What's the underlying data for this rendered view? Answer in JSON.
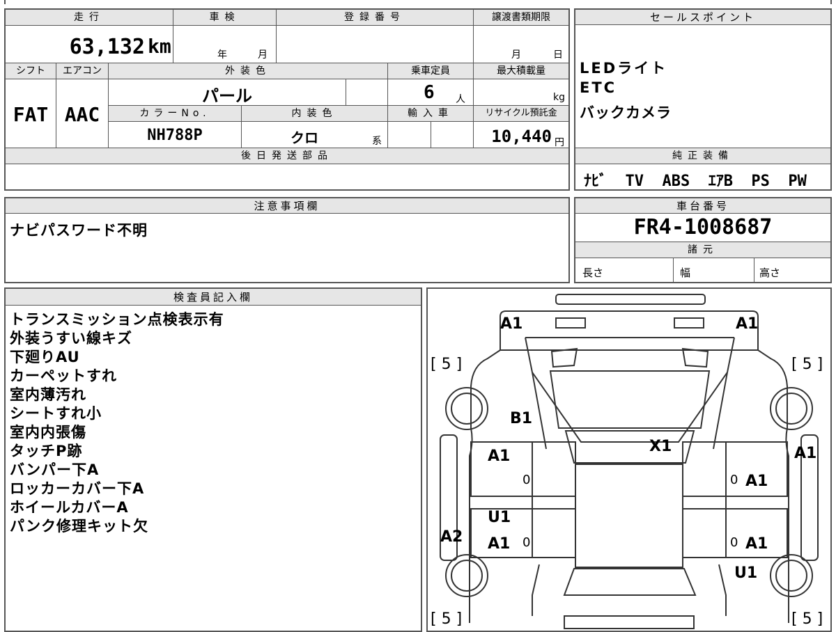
{
  "top_row": {
    "mileage_label": "走行",
    "inspection_label": "車検",
    "registration_label": "登録番号",
    "transfer_deadline_label": "譲渡書類期限",
    "mileage_value": "63,132",
    "mileage_unit": "km",
    "year_unit": "年",
    "month_unit": "月",
    "deadline_month": "月",
    "deadline_day": "日"
  },
  "second_row": {
    "shift_label": "シフト",
    "aircon_label": "エアコン",
    "exterior_color_label": "外装色",
    "capacity_label": "乗車定員",
    "max_load_label": "最大積載量",
    "shift_value": "FAT",
    "aircon_value": "AAC",
    "exterior_color_value": "パール",
    "capacity_value": "6",
    "capacity_unit": "人",
    "load_unit": "kg",
    "color_no_label": "カラーNo.",
    "interior_color_label": "内装色",
    "import_label": "輸入車",
    "recycle_label": "リサイクル預託金",
    "color_no_value": "NH788P",
    "interior_color_value": "クロ",
    "interior_color_suffix": "系",
    "recycle_value": "10,440",
    "recycle_unit": "円"
  },
  "later_parts": {
    "label": "後日発送部品",
    "value": ""
  },
  "sales_points": {
    "label": "セールスポイント",
    "items": [
      "LEDライト",
      "ETC",
      "バックカメラ"
    ]
  },
  "genuine_equipment": {
    "label": "純正装備",
    "value": "ﾅﾋﾞ  TV  ABS  ｴｱB  PS  PW"
  },
  "notes": {
    "label": "注意事項欄",
    "value": "ナビパスワード不明"
  },
  "chassis": {
    "label": "車台番号",
    "value": "FR4-1008687"
  },
  "specs": {
    "label": "諸元",
    "length": "長さ",
    "width": "幅",
    "height": "高さ"
  },
  "inspector": {
    "label": "検査員記入欄",
    "lines": [
      "トランスミッション点検表示有",
      "外装うすい線キズ",
      "下廻りAU",
      "カーペットすれ",
      "室内薄汚れ",
      "シートすれ小",
      "室内内張傷",
      "タッチP跡",
      "バンパー下A",
      "ロッカーカバー下A",
      "ホイールカバーA",
      "パンク修理キット欠"
    ]
  },
  "diagram": {
    "marks": {
      "front_left": "A1",
      "front_right": "A1",
      "bracket_tl": "[ 5 ]",
      "bracket_tr": "[ 5 ]",
      "bracket_bl": "[ 5 ]",
      "bracket_br": "[ 5 ]",
      "bonnet": "B1",
      "roof": "X1",
      "left_fender": "A1",
      "right_fender": "A1",
      "right_front_door": "A1",
      "left_rear_u": "U1",
      "left_rear_door": "A1",
      "left_rocker": "A2",
      "right_rear_door": "A1",
      "right_rear_u": "U1",
      "left_zero_1": "0",
      "left_zero_2": "0",
      "right_zero_1": "0",
      "right_zero_2": "0"
    }
  }
}
